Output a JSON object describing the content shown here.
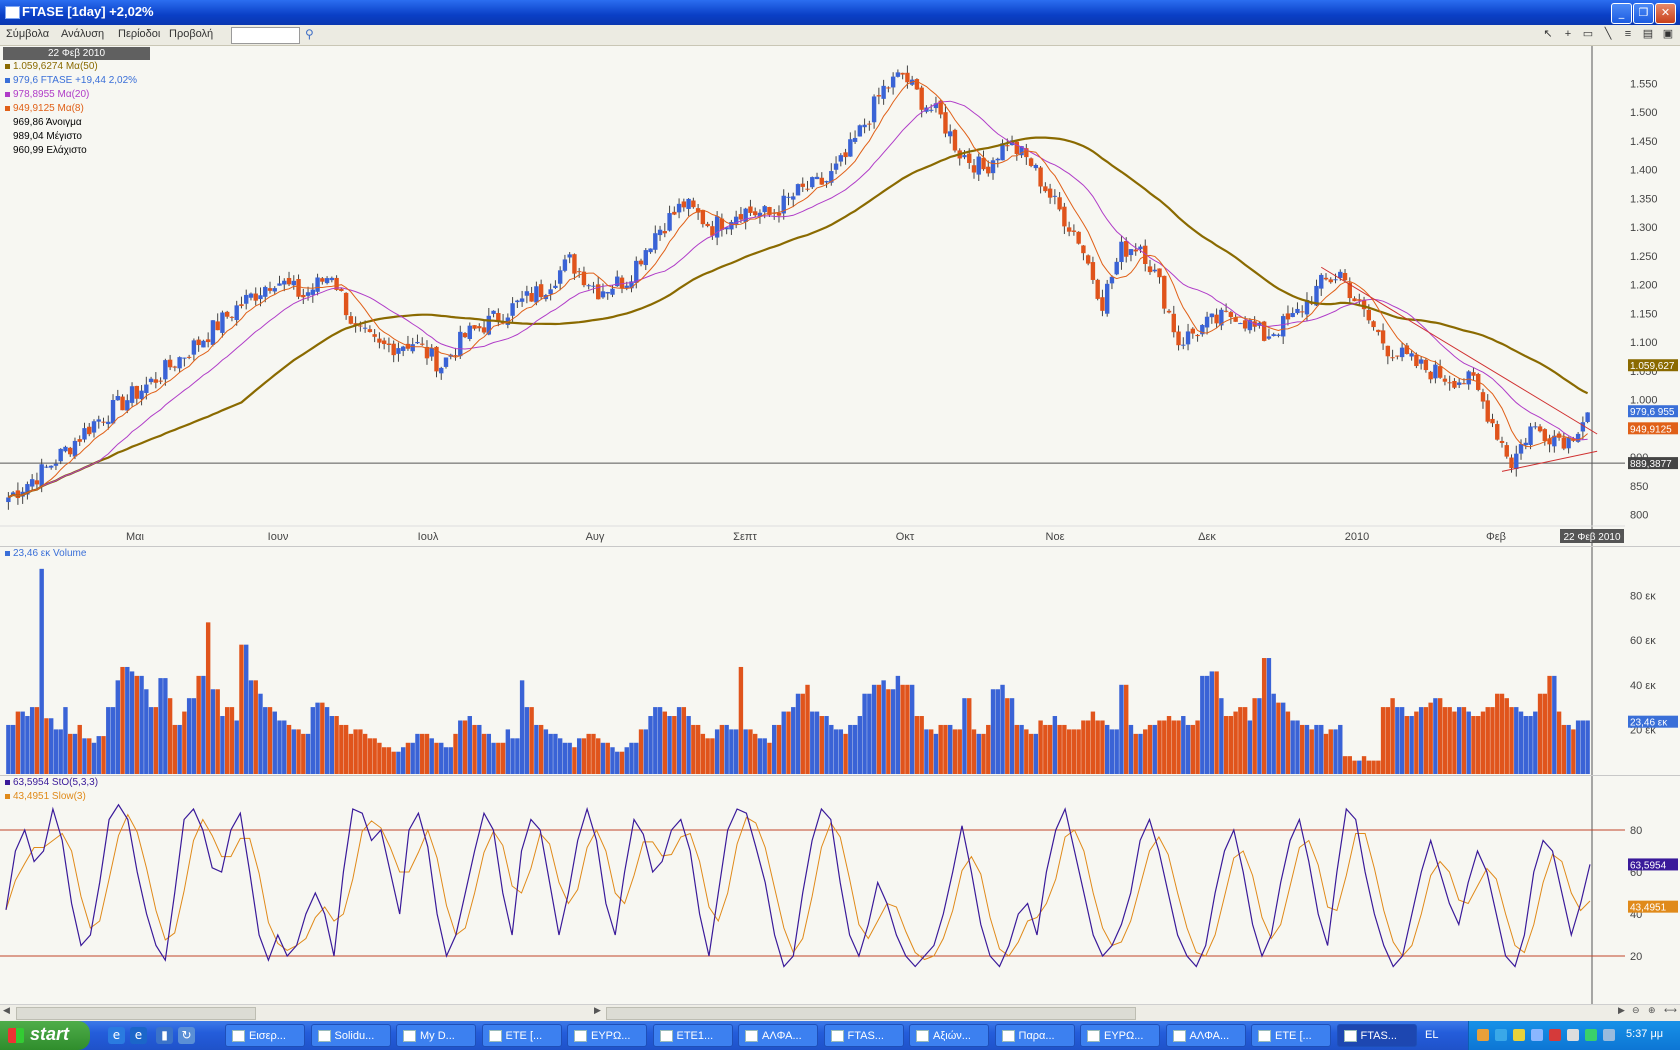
{
  "window": {
    "title": "FTASE [1day] +2,02%"
  },
  "menu": {
    "items": [
      "Σύμβολα",
      "Ανάλυση",
      "Περίοδοι",
      "Προβολή"
    ],
    "search_value": ""
  },
  "price_panel": {
    "date_box": "22 Φεβ 2010",
    "legend": [
      {
        "text": "1.059,6274 Mα(50)",
        "color": "#8a6a00"
      },
      {
        "text": "979,6 FTASE +19,44 2,02%",
        "color": "#3a6fd8"
      },
      {
        "text": "978,8955 Mα(20)",
        "color": "#b03cc8"
      },
      {
        "text": "949,9125 Mα(8)",
        "color": "#e06018"
      },
      {
        "text": "969,86 Άνοιγμα",
        "color": "#3a6fd8"
      },
      {
        "text": "989,04 Μέγιστο",
        "color": "#3a6fd8"
      },
      {
        "text": "960,99 Ελάχιστο",
        "color": "#3a6fd8"
      }
    ],
    "y_ticks": [
      "1.550",
      "1.500",
      "1.450",
      "1.400",
      "1.350",
      "1.300",
      "1.250",
      "1.200",
      "1.150",
      "1.100",
      "1.050",
      "1.000",
      "950",
      "900",
      "850",
      "800"
    ],
    "x_labels": [
      "Μαι",
      "Ιουν",
      "Ιουλ",
      "Αυγ",
      "Σεπτ",
      "Οκτ",
      "Νοε",
      "Δεκ",
      "2010",
      "Φεβ"
    ],
    "x_last_label": "22 Φεβ 2010",
    "price_tags": [
      {
        "text": "1.059,627",
        "color": "#8a6a00",
        "value": 1059.6
      },
      {
        "text": "979,6 955",
        "color": "#3a6fd8",
        "value": 979.6
      },
      {
        "text": "949,9125",
        "color": "#e06018",
        "value": 949.9
      },
      {
        "text": "889,3877",
        "color": "#444444",
        "value": 889.4
      }
    ],
    "hline_value": 889.4
  },
  "volume_panel": {
    "legend": "23,46 εκ Volume",
    "y_ticks": [
      "80 εκ",
      "60 εκ",
      "40 εκ",
      "20 εκ"
    ],
    "last_tag": "23,46 εκ"
  },
  "stoch_panel": {
    "legend": [
      {
        "text": "63,5954 StO(5,3,3)",
        "color": "#3a1a9a"
      },
      {
        "text": "43,4951 Slow(3)",
        "color": "#e08a1a"
      }
    ],
    "y_ticks": [
      "80",
      "60",
      "40",
      "20"
    ],
    "tags": [
      {
        "text": "63,5954",
        "color": "#3a1a9a",
        "value": 63.6
      },
      {
        "text": "43,4951",
        "color": "#e08a1a",
        "value": 43.5
      }
    ]
  },
  "chart_data": {
    "type": "candlestick",
    "symbol": "FTASE",
    "ylim": [
      780,
      1580
    ],
    "months": [
      "Μαι",
      "Ιουν",
      "Ιουλ",
      "Αυγ",
      "Σεπτ",
      "Οκτ",
      "Νοε",
      "Δεκ",
      "2010",
      "Φεβ"
    ],
    "close_path": [
      [
        0,
        830
      ],
      [
        8,
        880
      ],
      [
        18,
        960
      ],
      [
        30,
        1030
      ],
      [
        40,
        1100
      ],
      [
        48,
        1160
      ],
      [
        56,
        1210
      ],
      [
        62,
        1180
      ],
      [
        68,
        1220
      ],
      [
        73,
        1120
      ],
      [
        78,
        1090
      ],
      [
        85,
        1100
      ],
      [
        91,
        1060
      ],
      [
        96,
        1110
      ],
      [
        104,
        1150
      ],
      [
        112,
        1190
      ],
      [
        118,
        1240
      ],
      [
        124,
        1190
      ],
      [
        130,
        1210
      ],
      [
        136,
        1290
      ],
      [
        142,
        1340
      ],
      [
        148,
        1300
      ],
      [
        154,
        1330
      ],
      [
        160,
        1320
      ],
      [
        166,
        1360
      ],
      [
        172,
        1380
      ],
      [
        176,
        1420
      ],
      [
        180,
        1480
      ],
      [
        184,
        1540
      ],
      [
        188,
        1565
      ],
      [
        192,
        1520
      ],
      [
        196,
        1490
      ],
      [
        200,
        1430
      ],
      [
        205,
        1400
      ],
      [
        210,
        1450
      ],
      [
        215,
        1410
      ],
      [
        220,
        1340
      ],
      [
        225,
        1280
      ],
      [
        230,
        1170
      ],
      [
        234,
        1260
      ],
      [
        238,
        1270
      ],
      [
        242,
        1200
      ],
      [
        246,
        1100
      ],
      [
        252,
        1130
      ],
      [
        258,
        1150
      ],
      [
        264,
        1110
      ],
      [
        270,
        1140
      ],
      [
        276,
        1200
      ],
      [
        280,
        1220
      ],
      [
        284,
        1160
      ],
      [
        290,
        1090
      ],
      [
        296,
        1060
      ],
      [
        302,
        1040
      ],
      [
        308,
        1030
      ],
      [
        312,
        960
      ],
      [
        316,
        890
      ],
      [
        320,
        950
      ],
      [
        324,
        940
      ],
      [
        328,
        930
      ],
      [
        332,
        980
      ]
    ],
    "volume_m": [
      22,
      28,
      26,
      30,
      92,
      25,
      20,
      30,
      18,
      22,
      16,
      14,
      17,
      30,
      42,
      48,
      46,
      44,
      38,
      30,
      43,
      34,
      22,
      28,
      34,
      44,
      68,
      38,
      26,
      30,
      24,
      58,
      42,
      36,
      30,
      28,
      24,
      22,
      20,
      18,
      30,
      32,
      30,
      26,
      22,
      18,
      20,
      18,
      16,
      14,
      12,
      10,
      12,
      14,
      18,
      18,
      16,
      14,
      12,
      18,
      24,
      26,
      22,
      18,
      14,
      14,
      20,
      16,
      42,
      30,
      22,
      20,
      18,
      16,
      14,
      12,
      16,
      18,
      16,
      14,
      12,
      10,
      12,
      14,
      20,
      26,
      30,
      28,
      26,
      30,
      26,
      22,
      18,
      16,
      20,
      22,
      20,
      48,
      20,
      18,
      16,
      14,
      22,
      28,
      30,
      36,
      40,
      28,
      26,
      22,
      20,
      18,
      22,
      26,
      36,
      40,
      42,
      38,
      44,
      40,
      40,
      26,
      20,
      18,
      22,
      22,
      20,
      34,
      20,
      18,
      22,
      38,
      40,
      34,
      22,
      20,
      18,
      24,
      22,
      26,
      22,
      20,
      20,
      24,
      28,
      24,
      22,
      20,
      40,
      22,
      18,
      20,
      22,
      24,
      26,
      24,
      26,
      22,
      24,
      44,
      46,
      34,
      26,
      28,
      30,
      24,
      34,
      52,
      36,
      32,
      28,
      24,
      22,
      20,
      22,
      18,
      20,
      22,
      8,
      6,
      8,
      6,
      6,
      30,
      34,
      30,
      26,
      28,
      30,
      32,
      34,
      30,
      28,
      30,
      28,
      26,
      28,
      30,
      36,
      34,
      30,
      28,
      26,
      28,
      36,
      44,
      28,
      22,
      20,
      24,
      24
    ],
    "stochastic": {
      "fast_last": 63.5954,
      "slow_last": 43.4951,
      "fast": [
        42,
        70,
        80,
        65,
        70,
        90,
        75,
        45,
        25,
        30,
        55,
        85,
        92,
        85,
        60,
        40,
        25,
        18,
        50,
        85,
        90,
        80,
        62,
        60,
        80,
        88,
        60,
        30,
        18,
        30,
        20,
        25,
        40,
        50,
        40,
        20,
        60,
        90,
        88,
        75,
        80,
        60,
        40,
        80,
        88,
        72,
        40,
        20,
        30,
        50,
        70,
        88,
        80,
        50,
        30,
        70,
        85,
        80,
        55,
        30,
        50,
        75,
        90,
        75,
        45,
        30,
        60,
        85,
        78,
        60,
        65,
        80,
        85,
        70,
        40,
        20,
        50,
        80,
        90,
        88,
        72,
        55,
        30,
        15,
        20,
        50,
        75,
        90,
        85,
        55,
        30,
        20,
        35,
        55,
        45,
        30,
        20,
        15,
        20,
        25,
        40,
        60,
        82,
        60,
        35,
        20,
        15,
        25,
        40,
        45,
        30,
        60,
        80,
        90,
        70,
        50,
        30,
        20,
        25,
        35,
        50,
        75,
        85,
        70,
        50,
        30,
        20,
        15,
        25,
        50,
        70,
        80,
        60,
        35,
        20,
        30,
        55,
        75,
        85,
        65,
        40,
        25,
        60,
        90,
        85,
        60,
        40,
        25,
        15,
        20,
        40,
        60,
        75,
        60,
        45,
        35,
        55,
        70,
        60,
        40,
        20,
        15,
        30,
        60,
        75,
        70,
        50,
        30,
        45,
        63.6
      ],
      "reference_lines": [
        80,
        20
      ]
    }
  }
}
